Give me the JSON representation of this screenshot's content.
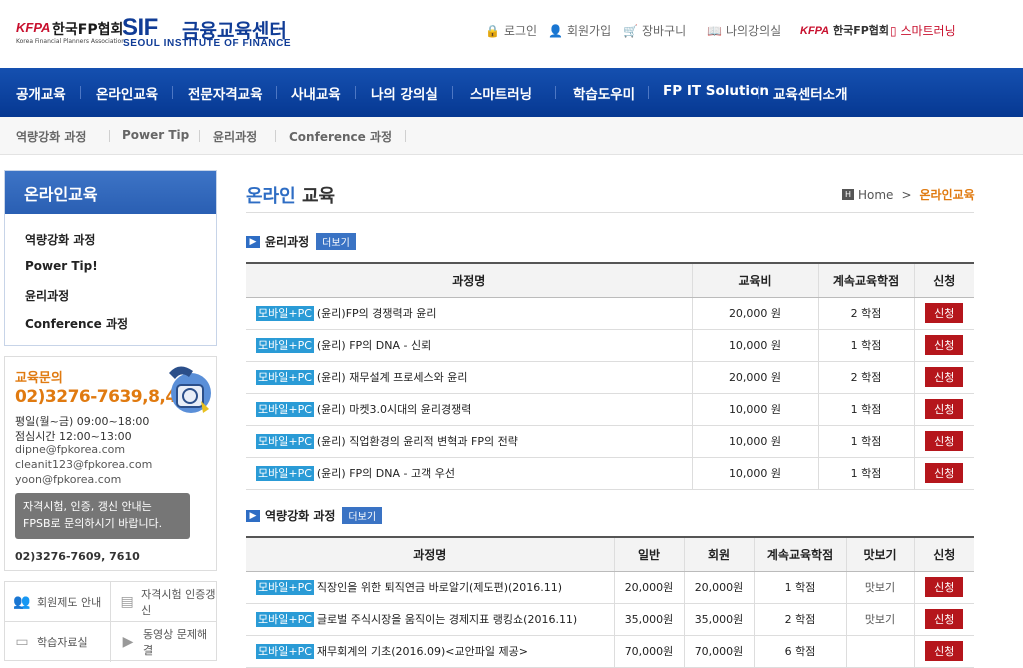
{
  "header": {
    "kfpa_logo": "KFPA",
    "kfpa_name": "한국FP협회",
    "kfpa_sub": "Korea Financial Planners Association",
    "sif_logo": "SIF",
    "sif_name": "금융교육센터",
    "sif_en": "SEOUL INSTITUTE OF FINANCE",
    "util": {
      "login": "로그인",
      "join": "회원가입",
      "cart": "장바구니",
      "my_class": "나의강의실",
      "kfpa": "KFPA",
      "kfpa_name": "한국FP협회",
      "smart": "스마트러닝"
    }
  },
  "gnb": [
    "공개교육",
    "온라인교육",
    "전문자격교육",
    "사내교육",
    "나의 강의실",
    "스마트러닝",
    "학습도우미",
    "FP IT Solution",
    "교육센터소개"
  ],
  "snb": [
    "역량강화 과정",
    "Power Tip",
    "윤리과정",
    "Conference 과정"
  ],
  "lnb": {
    "title": "온라인교육",
    "items": [
      "역량강화 과정",
      "Power Tip!",
      "윤리과정",
      "Conference 과정"
    ]
  },
  "contact": {
    "title": "교육문의",
    "phone": "02)3276-7639,8,4",
    "hours": "평일(월~금) 09:00~18:00",
    "lunch": "점심시간 12:00~13:00",
    "emails": [
      "dipne@fpkorea.com",
      "cleanit123@fpkorea.com",
      "yoon@fpkorea.com"
    ],
    "tooltip_1": "자격시험, 인증, 갱신 안내는",
    "tooltip_2": "FPSB로 문의하시기 바랍니다.",
    "bottom_phone": "02)3276-7609, 7610"
  },
  "quick_links": [
    "회원제도 안내",
    "자격시험 인증갱신",
    "학습자료실",
    "동영상 문제해결"
  ],
  "page": {
    "title_highlight": "온라인",
    "title_rest": " 교육",
    "breadcrumb_home": "Home",
    "breadcrumb_sep": ">",
    "breadcrumb_current": "온라인교육"
  },
  "section1": {
    "title": "윤리과정",
    "more": "더보기",
    "headers": [
      "과정명",
      "교육비",
      "계속교육학점",
      "신청"
    ],
    "rows": [
      {
        "tag": "모바일+PC",
        "name": "(윤리)FP의 경쟁력과 윤리",
        "fee": "20,000 원",
        "credit": "2 학점",
        "apply": "신청"
      },
      {
        "tag": "모바일+PC",
        "name": "(윤리) FP의 DNA - 신뢰",
        "fee": "10,000 원",
        "credit": "1 학점",
        "apply": "신청"
      },
      {
        "tag": "모바일+PC",
        "name": "(윤리) 재무설계 프로세스와 윤리",
        "fee": "20,000 원",
        "credit": "2 학점",
        "apply": "신청"
      },
      {
        "tag": "모바일+PC",
        "name": "(윤리) 마켓3.0시대의 윤리경쟁력",
        "fee": "10,000 원",
        "credit": "1 학점",
        "apply": "신청"
      },
      {
        "tag": "모바일+PC",
        "name": "(윤리) 직업환경의 윤리적 변혁과 FP의 전략",
        "fee": "10,000 원",
        "credit": "1 학점",
        "apply": "신청"
      },
      {
        "tag": "모바일+PC",
        "name": "(윤리) FP의 DNA - 고객 우선",
        "fee": "10,000 원",
        "credit": "1 학점",
        "apply": "신청"
      }
    ]
  },
  "section2": {
    "title": "역량강화 과정",
    "more": "더보기",
    "headers": [
      "과정명",
      "일반",
      "회원",
      "계속교육학점",
      "맛보기",
      "신청"
    ],
    "rows": [
      {
        "tag": "모바일+PC",
        "name": "직장인을 위한 퇴직연금 바로알기(제도편)(2016.11)",
        "general": "20,000원",
        "member": "20,000원",
        "credit": "1 학점",
        "preview": "맛보기",
        "apply": "신청"
      },
      {
        "tag": "모바일+PC",
        "name": "글로벌 주식시장을 움직이는 경제지표 랭킹쇼(2016.11)",
        "general": "35,000원",
        "member": "35,000원",
        "credit": "2 학점",
        "preview": "맛보기",
        "apply": "신청"
      },
      {
        "tag": "모바일+PC",
        "name": "재무회계의 기초(2016.09)<교안파일 제공>",
        "general": "70,000원",
        "member": "70,000원",
        "credit": "6 학점",
        "preview": "",
        "apply": "신청"
      }
    ]
  }
}
